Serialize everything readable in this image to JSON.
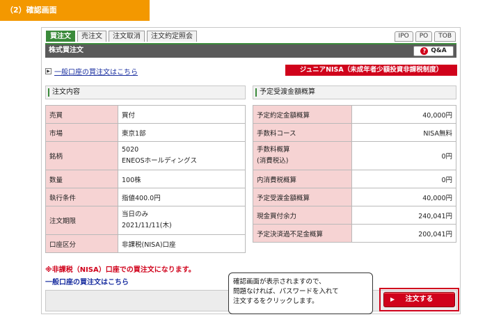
{
  "step_title": "（2）確認画面",
  "tabs": [
    {
      "label": "買注文",
      "active": true
    },
    {
      "label": "売注文",
      "active": false
    },
    {
      "label": "注文取消",
      "active": false
    },
    {
      "label": "注文約定照会",
      "active": false
    }
  ],
  "right_tabs": [
    "IPO",
    "PO",
    "TOB"
  ],
  "header": {
    "title": "株式買注文",
    "qa_label": "Q&A"
  },
  "general_account_link": "一般口座の買注文はこちら",
  "nisa_badge": "ジュニアNISA（未成年者少額投資非課税制度）",
  "order_section": {
    "heading": "注文内容",
    "rows": [
      {
        "label": "売買",
        "value": "買付"
      },
      {
        "label": "市場",
        "value": "東京1部"
      },
      {
        "label": "銘柄",
        "value": "5020",
        "value2": "ENEOSホールディングス"
      },
      {
        "label": "数量",
        "value": "100株"
      },
      {
        "label": "執行条件",
        "value": "指値400.0円"
      },
      {
        "label": "注文期限",
        "value": "当日のみ",
        "value2": "2021/11/11(木)"
      },
      {
        "label": "口座区分",
        "value": "非課税(NISA)口座"
      }
    ]
  },
  "estimate_section": {
    "heading": "予定受渡金額概算",
    "rows": [
      {
        "label": "予定約定金額概算",
        "value": "40,000円"
      },
      {
        "label": "手数料コース",
        "value": "NISA無料"
      },
      {
        "label": "手数料概算",
        "label2": "(消費税込)",
        "value": "0円"
      },
      {
        "label": "内消費税概算",
        "value": "0円"
      },
      {
        "label": "予定受渡金額概算",
        "value": "40,000円"
      },
      {
        "label": "現金買付余力",
        "value": "240,041円"
      },
      {
        "label": "予定決済過不足金概算",
        "value": "200,041円"
      }
    ]
  },
  "warning": "※非課税（NISA）口座での買注文になります。",
  "sub_link": "一般口座の買注文はこちら",
  "callout": {
    "line1": "確認画面が表示されますので、",
    "line2": "問題なければ、パスワードを入れて",
    "line3": "注文するをクリックします。"
  },
  "submit_button": "注文する",
  "colors": {
    "accent_green": "#3a8a3a",
    "alert_red": "#d0021b",
    "banner_orange": "#f39800",
    "label_pink": "#f6d3d3"
  }
}
